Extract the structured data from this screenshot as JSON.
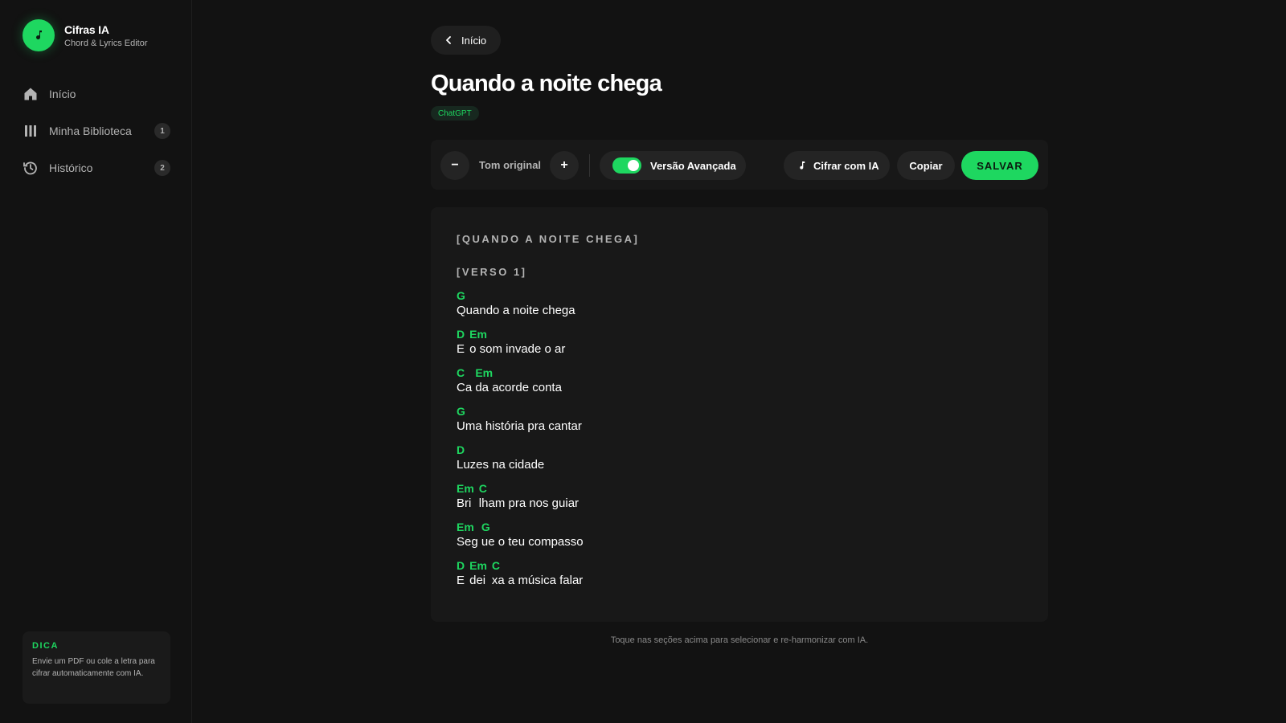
{
  "app": {
    "title": "Cifras IA",
    "subtitle": "Chord & Lyrics Editor",
    "logo_icon": "music-note-icon",
    "accent": "#1ed760"
  },
  "sidebar": {
    "items": [
      {
        "label": "Início",
        "icon": "home-icon",
        "badge": ""
      },
      {
        "label": "Minha Biblioteca",
        "icon": "library-icon",
        "badge": "1"
      },
      {
        "label": "Histórico",
        "icon": "history-icon",
        "badge": "2"
      }
    ],
    "tip": {
      "title": "DICA",
      "text": "Envie um PDF ou cole a letra para cifrar automaticamente com IA."
    }
  },
  "header": {
    "back_label": "Início",
    "title": "Quando a noite chega",
    "tag": "ChatGPT"
  },
  "toolbar": {
    "minus_label": "−",
    "plus_label": "+",
    "tom_label": "Tom original",
    "advanced_label": "Versão Avançada",
    "advanced_enabled": true,
    "cifrar_label": "Cifrar com IA",
    "copy_label": "Copiar",
    "save_label": "SALVAR"
  },
  "sheet": {
    "title": "[QUANDO A NOITE CHEGA]",
    "sections": [
      {
        "label": "[VERSO 1]",
        "lines": [
          {
            "segments": [
              {
                "chord": "G",
                "lyric": "Quando a noite chega"
              }
            ]
          },
          {
            "segments": [
              {
                "chord": "D",
                "lyric": "E "
              },
              {
                "chord": "Em",
                "lyric": "o som invade o ar"
              }
            ]
          },
          {
            "segments": [
              {
                "chord": "C",
                "lyric": "Ca "
              },
              {
                "chord": "Em",
                "lyric": "da acorde conta"
              }
            ]
          },
          {
            "segments": [
              {
                "chord": "G",
                "lyric": "Uma história pra cantar"
              }
            ]
          },
          {
            "segments": [
              {
                "chord": "D",
                "lyric": "Luzes na cidade"
              }
            ]
          },
          {
            "segments": [
              {
                "chord": "Em",
                "lyric": "Bri "
              },
              {
                "chord": "C",
                "lyric": "lham pra nos guiar"
              }
            ]
          },
          {
            "segments": [
              {
                "chord": "Em",
                "lyric": "Seg "
              },
              {
                "chord": "G",
                "lyric": "ue o teu compasso"
              }
            ]
          },
          {
            "segments": [
              {
                "chord": "D",
                "lyric": "E "
              },
              {
                "chord": "Em",
                "lyric": "dei "
              },
              {
                "chord": "C",
                "lyric": "xa a música falar"
              }
            ]
          }
        ]
      }
    ]
  },
  "footnote": "Toque nas seções acima para selecionar e re-harmonizar com IA."
}
